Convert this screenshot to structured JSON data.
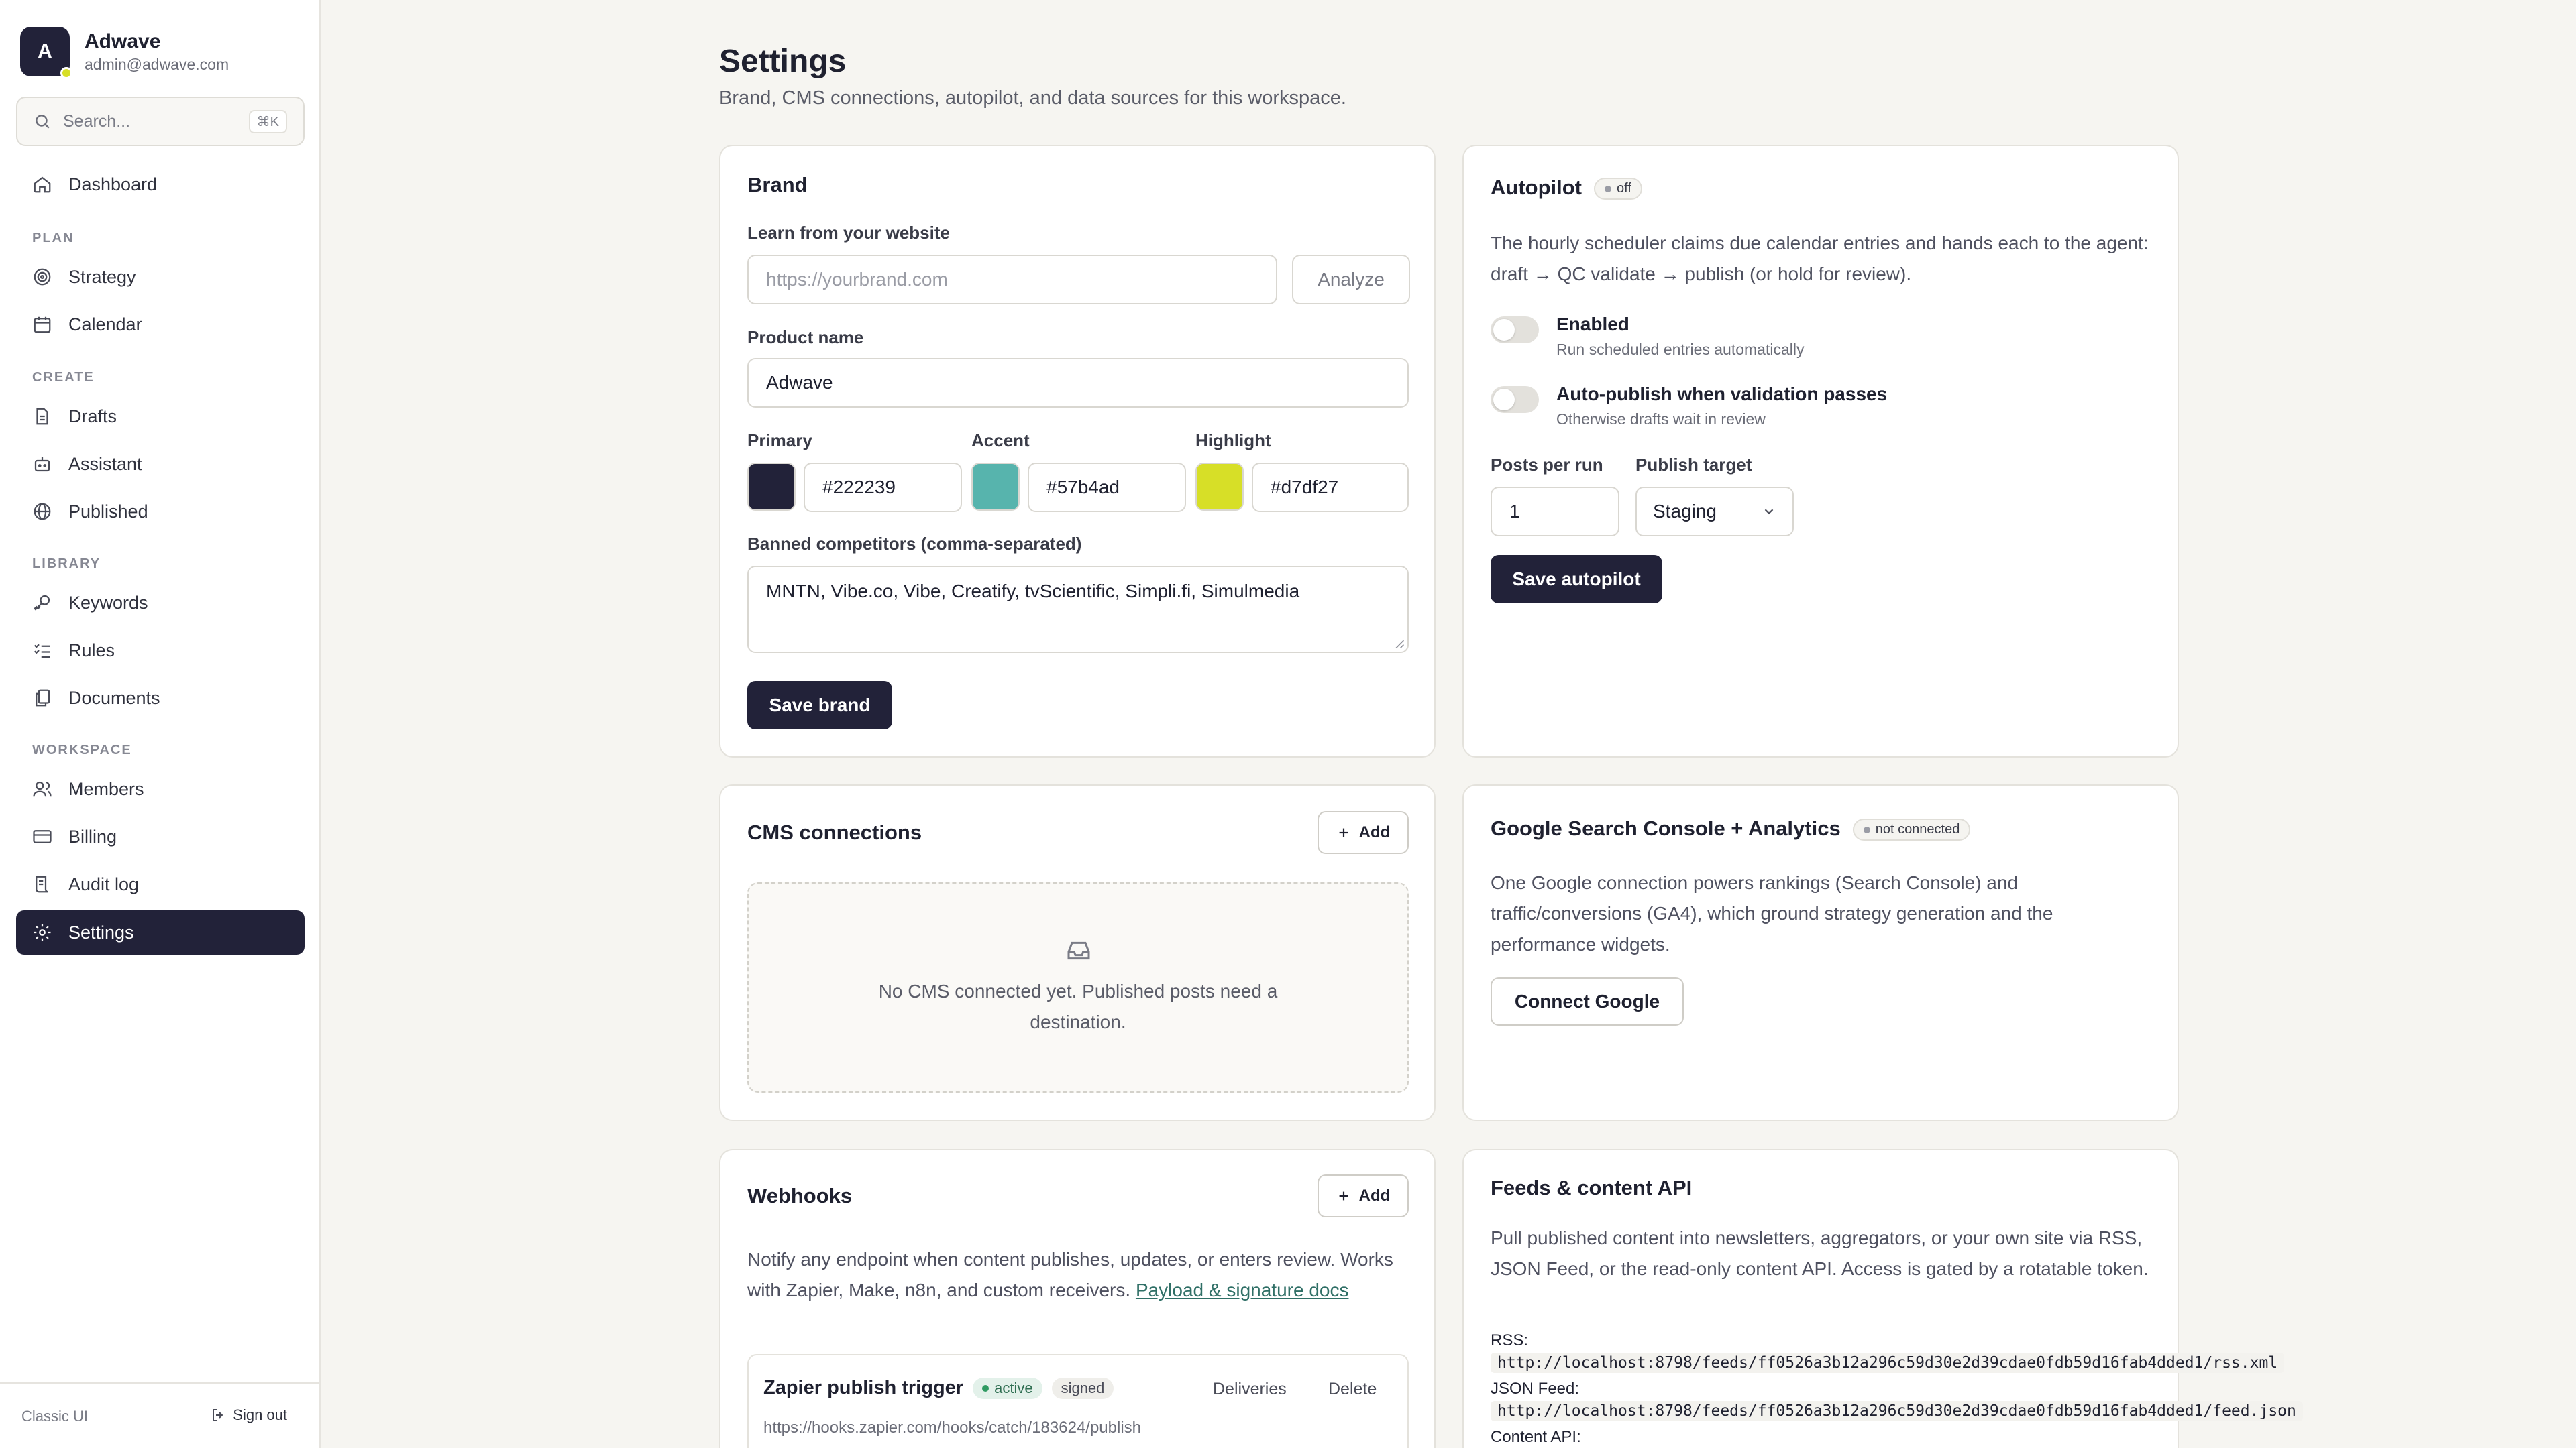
{
  "workspace": {
    "initial": "A",
    "name": "Adwave",
    "email": "admin@adwave.com"
  },
  "search": {
    "placeholder": "Search...",
    "shortcut": "⌘K"
  },
  "nav": {
    "dashboard": "Dashboard",
    "plan_section": "PLAN",
    "strategy": "Strategy",
    "calendar": "Calendar",
    "create_section": "CREATE",
    "drafts": "Drafts",
    "assistant": "Assistant",
    "published": "Published",
    "library_section": "LIBRARY",
    "keywords": "Keywords",
    "rules": "Rules",
    "documents": "Documents",
    "workspace_section": "WORKSPACE",
    "members": "Members",
    "billing": "Billing",
    "audit_log": "Audit log",
    "settings": "Settings"
  },
  "footer": {
    "classic": "Classic UI",
    "sign_out": "Sign out"
  },
  "page": {
    "title": "Settings",
    "subtitle": "Brand, CMS connections, autopilot, and data sources for this workspace."
  },
  "brand": {
    "title": "Brand",
    "learn_label": "Learn from your website",
    "website_placeholder": "https://yourbrand.com",
    "analyze": "Analyze",
    "product_label": "Product name",
    "product_value": "Adwave",
    "primary_label": "Primary",
    "primary_value": "#222239",
    "accent_label": "Accent",
    "accent_value": "#57b4ad",
    "highlight_label": "Highlight",
    "highlight_value": "#d7df27",
    "banned_label": "Banned competitors (comma-separated)",
    "banned_value": "MNTN, Vibe.co, Vibe, Creatify, tvScientific, Simpli.fi, Simulmedia",
    "save": "Save brand"
  },
  "autopilot": {
    "title": "Autopilot",
    "status": "off",
    "description": "The hourly scheduler claims due calendar entries and hands each to the agent: draft → QC validate → publish (or hold for review).",
    "enabled_title": "Enabled",
    "enabled_sub": "Run scheduled entries automatically",
    "autopublish_title": "Auto-publish when validation passes",
    "autopublish_sub": "Otherwise drafts wait in review",
    "posts_label": "Posts per run",
    "posts_value": "1",
    "target_label": "Publish target",
    "target_value": "Staging",
    "save": "Save autopilot"
  },
  "cms": {
    "title": "CMS connections",
    "add": "Add",
    "empty_line1": "No CMS connected yet. Published posts need a",
    "empty_line2": "destination."
  },
  "google": {
    "title": "Google Search Console + Analytics",
    "status": "not connected",
    "description": "One Google connection powers rankings (Search Console) and traffic/conversions (GA4), which ground strategy generation and the performance widgets.",
    "connect": "Connect Google"
  },
  "webhooks": {
    "title": "Webhooks",
    "add": "Add",
    "description": "Notify any endpoint when content publishes, updates, or enters review. Works with Zapier, Make, n8n, and custom receivers.",
    "docs_link": "Payload & signature docs",
    "hook_name": "Zapier publish trigger",
    "hook_status": "active",
    "hook_signed": "signed",
    "hook_url": "https://hooks.zapier.com/hooks/catch/183624/publish",
    "deliveries": "Deliveries",
    "delete": "Delete"
  },
  "feeds": {
    "title": "Feeds & content API",
    "description": "Pull published content into newsletters, aggregators, or your own site via RSS, JSON Feed, or the read-only content API. Access is gated by a rotatable token.",
    "rss_label": "RSS:",
    "rss_url": "http://localhost:8798/feeds/ff0526a3b12a296c59d30e2d39cdae0fdb59d16fab4dded1/rss.xml",
    "json_label": "JSON Feed:",
    "json_url": "http://localhost:8798/feeds/ff0526a3b12a296c59d30e2d39cdae0fdb59d16fab4dded1/feed.json",
    "api_label": "Content API:"
  },
  "colors": {
    "primary": "#222239",
    "accent": "#57b4ad",
    "highlight": "#d7df27"
  }
}
